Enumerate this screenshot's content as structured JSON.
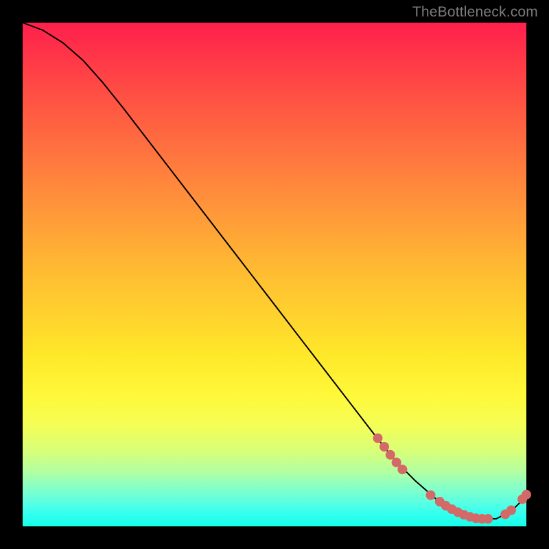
{
  "watermark": "TheBottleneck.com",
  "chart_data": {
    "type": "line",
    "title": "",
    "xlabel": "",
    "ylabel": "",
    "xlim": [
      0,
      100
    ],
    "ylim": [
      0,
      100
    ],
    "grid": false,
    "legend": false,
    "background": "red-yellow-green vertical gradient",
    "series": [
      {
        "name": "curve",
        "x": [
          0,
          4,
          8,
          12,
          16,
          20,
          25,
          30,
          35,
          40,
          45,
          50,
          55,
          60,
          65,
          70,
          74,
          78,
          82,
          86,
          90,
          94,
          97,
          100
        ],
        "y": [
          100,
          98.5,
          96,
          92.5,
          88,
          83,
          76.5,
          70,
          63.5,
          57,
          50.5,
          44,
          37.5,
          31,
          24.5,
          18,
          13,
          9,
          5.5,
          3,
          1.5,
          1.5,
          3,
          6
        ]
      }
    ],
    "markers": [
      {
        "x": 70.5,
        "y": 17.5
      },
      {
        "x": 71.8,
        "y": 15.8
      },
      {
        "x": 73.0,
        "y": 14.2
      },
      {
        "x": 74.2,
        "y": 12.7
      },
      {
        "x": 75.4,
        "y": 11.3
      },
      {
        "x": 81.0,
        "y": 6.2
      },
      {
        "x": 82.8,
        "y": 4.9
      },
      {
        "x": 84.0,
        "y": 4.1
      },
      {
        "x": 85.2,
        "y": 3.4
      },
      {
        "x": 86.4,
        "y": 2.8
      },
      {
        "x": 87.6,
        "y": 2.3
      },
      {
        "x": 88.8,
        "y": 1.9
      },
      {
        "x": 90.0,
        "y": 1.6
      },
      {
        "x": 91.2,
        "y": 1.5
      },
      {
        "x": 92.4,
        "y": 1.5
      },
      {
        "x": 95.8,
        "y": 2.4
      },
      {
        "x": 97.0,
        "y": 3.2
      },
      {
        "x": 99.2,
        "y": 5.4
      },
      {
        "x": 100.0,
        "y": 6.3
      }
    ],
    "marker_color": "#d36a67",
    "marker_radius_px": 7
  }
}
